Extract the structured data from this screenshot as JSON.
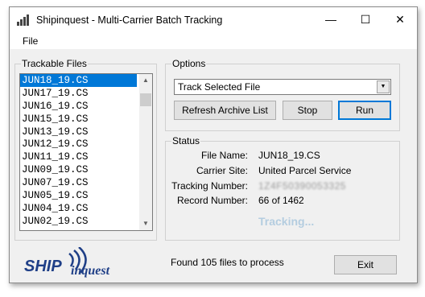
{
  "window": {
    "title": "Shipinquest - Multi-Carrier Batch Tracking",
    "minimize_glyph": "—",
    "maximize_glyph": "☐",
    "close_glyph": "✕"
  },
  "menu": {
    "file_label": "File"
  },
  "files_panel": {
    "label": "Trackable Files",
    "items": [
      "JUN18_19.CS",
      "JUN17_19.CS",
      "JUN16_19.CS",
      "JUN15_19.CS",
      "JUN13_19.CS",
      "JUN12_19.CS",
      "JUN11_19.CS",
      "JUN09_19.CS",
      "JUN07_19.CS",
      "JUN05_19.CS",
      "JUN04_19.CS",
      "JUN02_19.CS"
    ],
    "selected_index": 0
  },
  "options": {
    "label": "Options",
    "mode_selected": "Track Selected File",
    "refresh_label": "Refresh Archive List",
    "stop_label": "Stop",
    "run_label": "Run"
  },
  "status": {
    "label": "Status",
    "file_name_label": "File Name:",
    "file_name_value": "JUN18_19.CS",
    "carrier_label": "Carrier Site:",
    "carrier_value": "United Parcel Service",
    "tracking_label": "Tracking Number:",
    "tracking_value": "1Z4F50390053325",
    "record_label": "Record Number:",
    "record_value": "66 of 1462",
    "activity_text": "Tracking..."
  },
  "footer": {
    "logo_text_a": "SHIP",
    "logo_text_b": "inquest",
    "message": "Found 105 files to process",
    "exit_label": "Exit"
  },
  "colors": {
    "selection": "#0078d7",
    "logo_blue": "#1f3f87",
    "tracking_text": "#b4cde0"
  },
  "icons": [
    "shipinquest-app-icon",
    "minimize-icon",
    "maximize-icon",
    "close-icon",
    "scroll-up-icon",
    "scroll-down-icon",
    "dropdown-arrow-icon",
    "shipinquest-logo"
  ]
}
